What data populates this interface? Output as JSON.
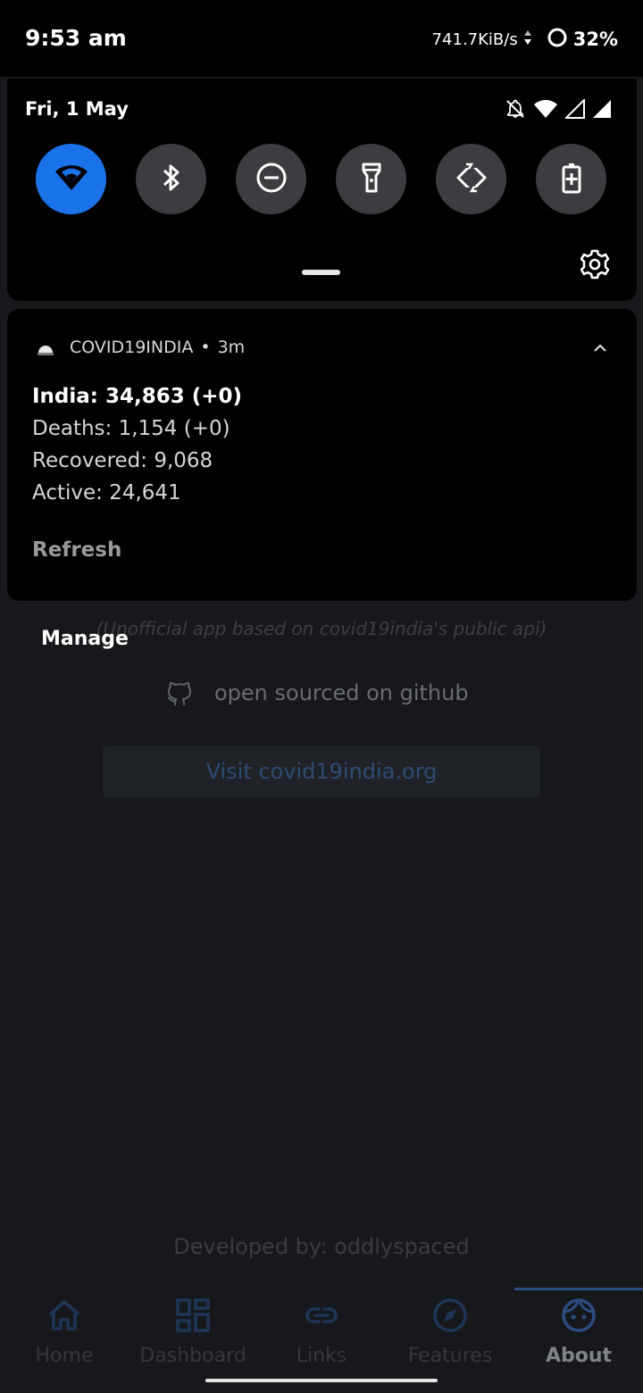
{
  "status_bar": {
    "time": "9:53 am",
    "net_speed": "741.7KiB/s",
    "battery": "32%"
  },
  "quick_settings": {
    "date": "Fri, 1 May",
    "tiles": [
      {
        "icon": "wifi-icon",
        "active": true
      },
      {
        "icon": "bluetooth-icon",
        "active": false
      },
      {
        "icon": "do-not-disturb-icon",
        "active": false
      },
      {
        "icon": "flashlight-icon",
        "active": false
      },
      {
        "icon": "auto-rotate-icon",
        "active": false
      },
      {
        "icon": "battery-saver-icon",
        "active": false
      }
    ],
    "accent_color": "#1a73e8"
  },
  "notification": {
    "app_name": "COVID19INDIA",
    "separator": "•",
    "time_ago": "3m",
    "title": "India: 34,863 (+0)",
    "lines": [
      "Deaths: 1,154 (+0)",
      "Recovered: 9,068",
      "Active: 24,641"
    ],
    "action": "Refresh"
  },
  "notification_shade": {
    "manage_label": "Manage"
  },
  "app": {
    "tagline": "(Unofficial app based on covid19india's public api)",
    "github_text": "open sourced on github",
    "visit_button": "Visit covid19india.org",
    "developed_by": "Developed by: oddlyspaced",
    "nav": [
      {
        "label": "Home",
        "icon": "home-icon",
        "active": false
      },
      {
        "label": "Dashboard",
        "icon": "dashboard-icon",
        "active": false
      },
      {
        "label": "Links",
        "icon": "link-icon",
        "active": false
      },
      {
        "label": "Features",
        "icon": "compass-icon",
        "active": false
      },
      {
        "label": "About",
        "icon": "face-icon",
        "active": true
      }
    ]
  }
}
